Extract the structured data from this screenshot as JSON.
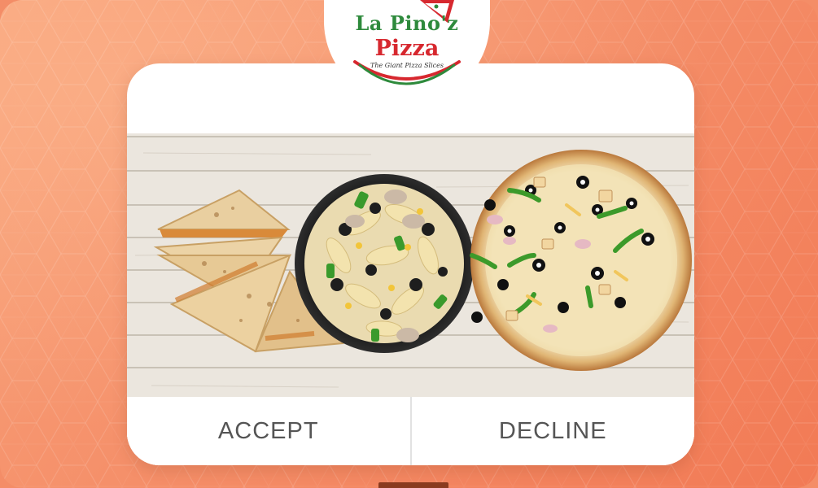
{
  "brand": {
    "name_line1": "La Pino'z",
    "name_line2": "Pizza",
    "tagline": "The Giant Pizza Slices"
  },
  "actions": {
    "accept_label": "ACCEPT",
    "decline_label": "DECLINE"
  },
  "colors": {
    "background": "#f48d67",
    "brand_green": "#2e8a3c",
    "brand_red": "#d7282f",
    "button_text": "#555555"
  },
  "images": {
    "food": "quesadilla-pasta-pizza-spread"
  }
}
